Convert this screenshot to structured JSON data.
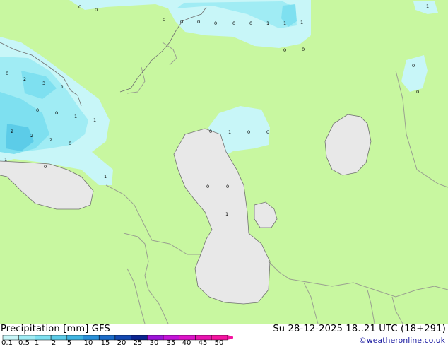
{
  "legend": {
    "title": "Precipitation [mm]  GFS",
    "valid_time": "Su 28-12-2025 18..21 UTC (18+291)",
    "credit": "©weatheronline.co.uk",
    "scale_values": [
      "0.1",
      "0.5",
      "1",
      "2",
      "5",
      "10",
      "15",
      "20",
      "25",
      "30",
      "35",
      "40",
      "45",
      "50"
    ],
    "scale_colors": [
      "#c8f6f8",
      "#a0ecf4",
      "#7ee0f0",
      "#5ccce8",
      "#40b4e0",
      "#2a90d8",
      "#1c6cc8",
      "#1448b0",
      "#0c2490",
      "#9c14d8",
      "#c414d8",
      "#dc14c8",
      "#e814b0",
      "#f414a0"
    ]
  },
  "colors": {
    "land": "#c8f7a0",
    "water": "#e8e8e8",
    "border": "#9aa090",
    "coast": "#707070"
  },
  "map_labels": [
    "0",
    "0",
    "0",
    "0",
    "0",
    "0",
    "0",
    "0",
    "1",
    "1",
    "1",
    "0",
    "0",
    "0",
    "2",
    "3",
    "1",
    "0",
    "0",
    "1",
    "1",
    "2",
    "2",
    "2",
    "0",
    "1",
    "0",
    "1",
    "0",
    "1",
    "0",
    "0",
    "0",
    "1",
    "0",
    "0",
    "0",
    "1"
  ]
}
